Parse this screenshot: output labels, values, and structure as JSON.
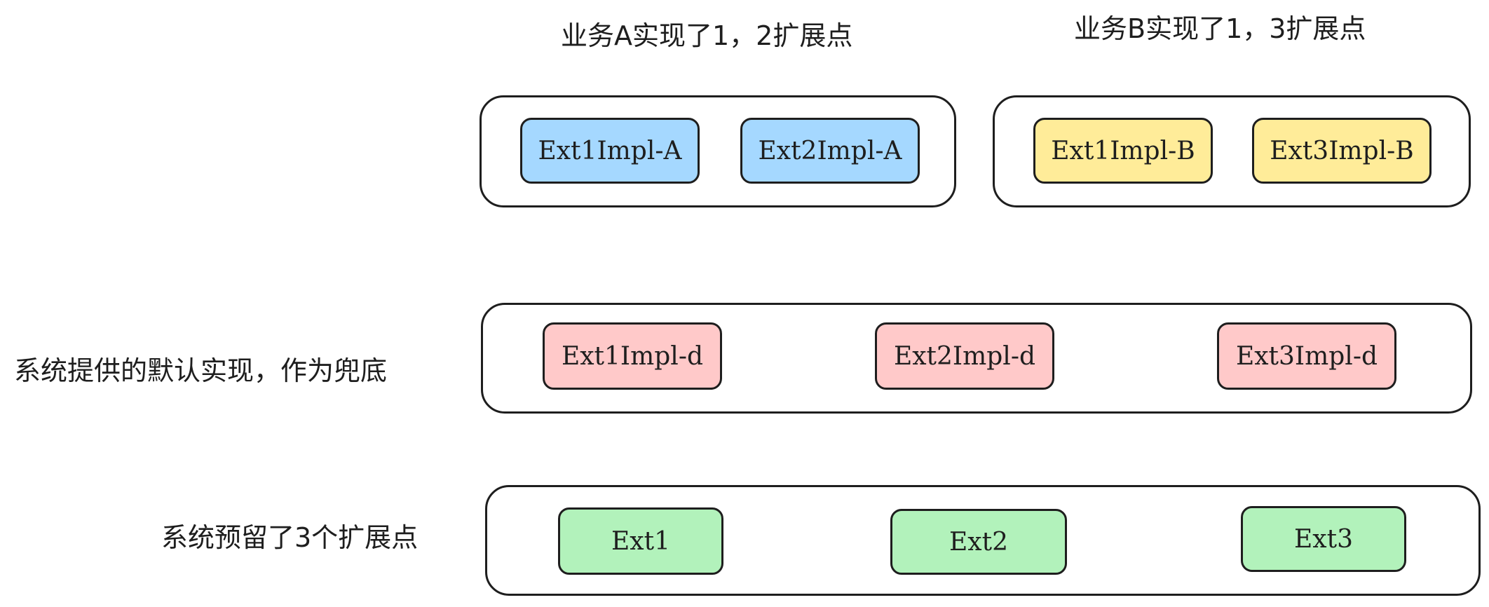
{
  "labels": {
    "business_a": "业务A实现了1，2扩展点",
    "business_b": "业务B实现了1，3扩展点",
    "system_default": "系统提供的默认实现，作为兜底",
    "system_reserved": "系统预留了3个扩展点"
  },
  "groups": {
    "business_a": {
      "items": [
        "Ext1Impl-A",
        "Ext2Impl-A"
      ],
      "color": "#a5d8ff"
    },
    "business_b": {
      "items": [
        "Ext1Impl-B",
        "Ext3Impl-B"
      ],
      "color": "#ffec99"
    },
    "default_impl": {
      "items": [
        "Ext1Impl-d",
        "Ext2Impl-d",
        "Ext3Impl-d"
      ],
      "color": "#ffc9c9"
    },
    "extension_points": {
      "items": [
        "Ext1",
        "Ext2",
        "Ext3"
      ],
      "color": "#b2f2bb"
    }
  },
  "colors": {
    "stroke": "#1e1e1e",
    "background": "#ffffff"
  }
}
